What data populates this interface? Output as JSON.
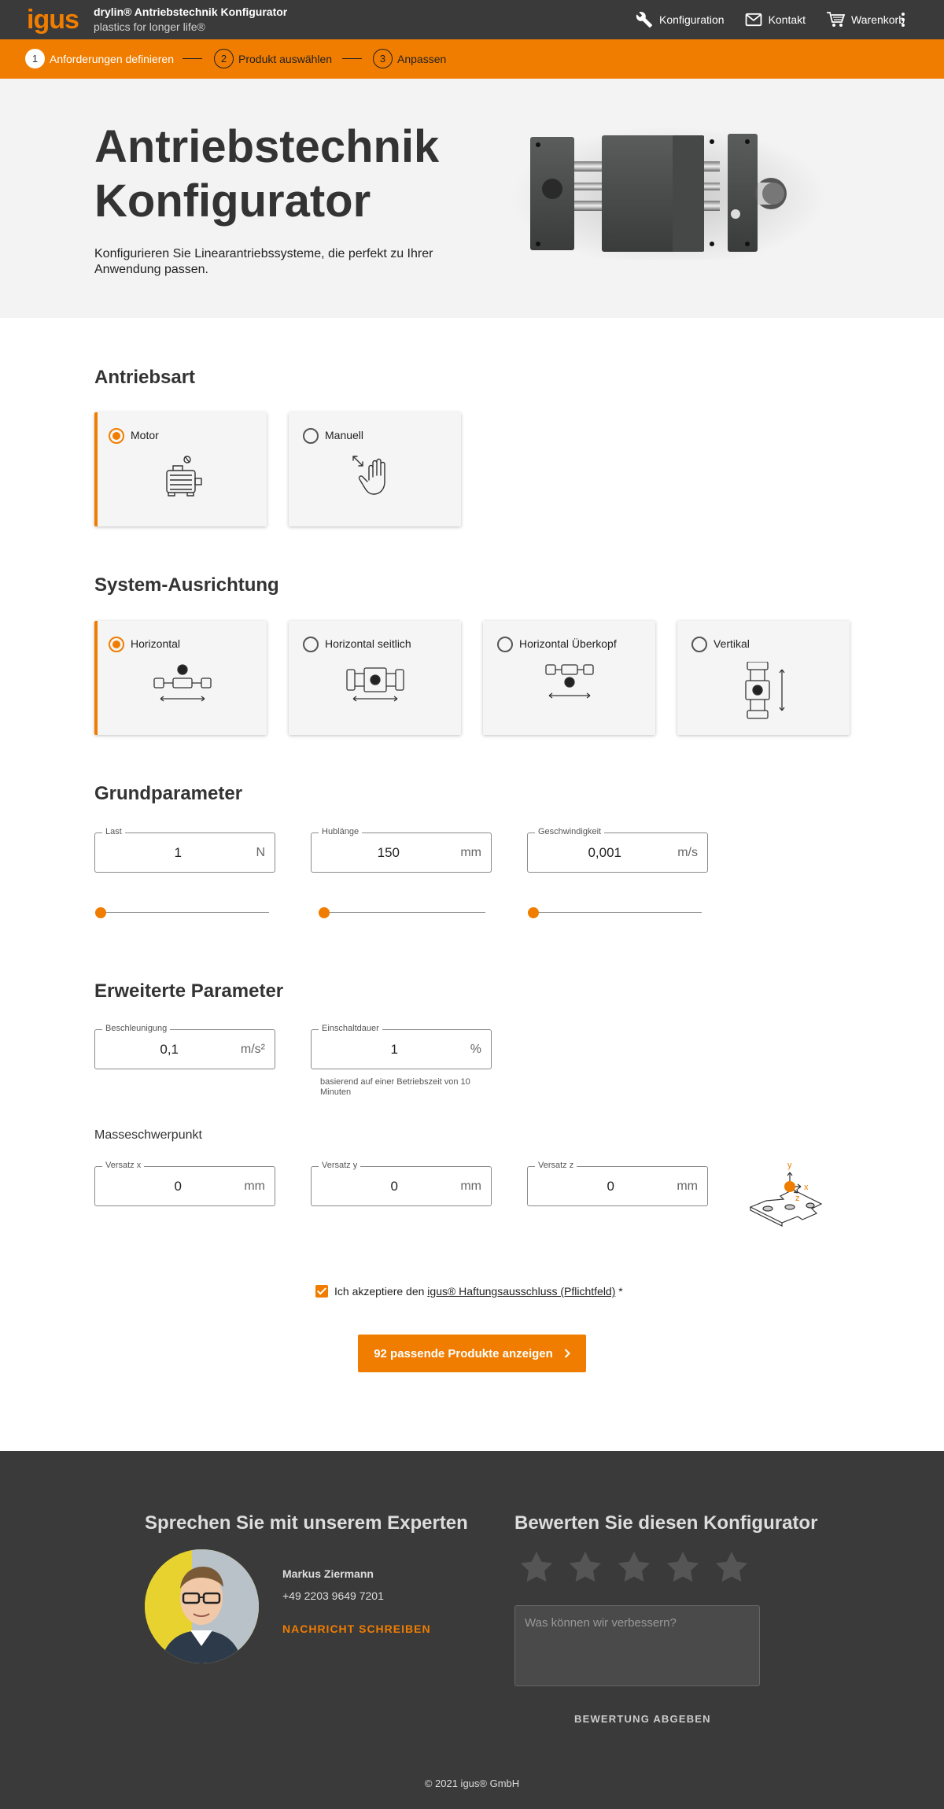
{
  "header": {
    "logo": "igus",
    "title": "drylin® Antriebstechnik Konfigurator",
    "subtitle": "plastics for longer life®",
    "nav": [
      {
        "label": "Konfiguration",
        "icon": "wrench-icon"
      },
      {
        "label": "Kontakt",
        "icon": "mail-icon"
      },
      {
        "label": "Warenkorb",
        "icon": "cart-icon"
      }
    ]
  },
  "stepper": [
    {
      "num": "1",
      "label": "Anforderungen definieren",
      "active": true
    },
    {
      "num": "2",
      "label": "Produkt auswählen",
      "active": false
    },
    {
      "num": "3",
      "label": "Anpassen",
      "active": false
    }
  ],
  "hero": {
    "title": "Antriebstechnik Konfigurator",
    "text": "Konfigurieren Sie Linearantriebssysteme, die perfekt zu Ihrer Anwendung passen."
  },
  "drive_type": {
    "title": "Antriebsart",
    "options": [
      {
        "label": "Motor",
        "selected": true,
        "icon": "motor-icon"
      },
      {
        "label": "Manuell",
        "selected": false,
        "icon": "hand-icon"
      }
    ]
  },
  "orientation": {
    "title": "System-Ausrichtung",
    "options": [
      {
        "label": "Horizontal",
        "selected": true,
        "icon": "horizontal-icon"
      },
      {
        "label": "Horizontal seitlich",
        "selected": false,
        "icon": "horizontal-side-icon"
      },
      {
        "label": "Horizontal Überkopf",
        "selected": false,
        "icon": "horizontal-overhead-icon"
      },
      {
        "label": "Vertikal",
        "selected": false,
        "icon": "vertical-icon"
      }
    ]
  },
  "basic": {
    "title": "Grundparameter",
    "fields": [
      {
        "label": "Last",
        "value": "1",
        "unit": "N",
        "slider_fraction": 0.0
      },
      {
        "label": "Hublänge",
        "value": "150",
        "unit": "mm",
        "slider_fraction": 0.0
      },
      {
        "label": "Geschwindigkeit",
        "value": "0,001",
        "unit": "m/s",
        "slider_fraction": 0.0
      }
    ]
  },
  "advanced": {
    "title": "Erweiterte Parameter",
    "fields": [
      {
        "label": "Beschleunigung",
        "value": "0,1",
        "unit": "m/s²"
      },
      {
        "label": "Einschaltdauer",
        "value": "1",
        "unit": "%"
      }
    ],
    "duty_hint": "basierend auf einer Betriebszeit von 10 Minuten",
    "center_of_mass": {
      "title": "Masseschwerpunkt",
      "fields": [
        {
          "label": "Versatz x",
          "value": "0",
          "unit": "mm"
        },
        {
          "label": "Versatz y",
          "value": "0",
          "unit": "mm"
        },
        {
          "label": "Versatz z",
          "value": "0",
          "unit": "mm"
        }
      ],
      "axes": [
        "y",
        "x",
        "z"
      ]
    }
  },
  "consent": {
    "prefix": "Ich akzeptiere den ",
    "link": "igus® Haftungsausschluss (Pflichtfeld)",
    "suffix": " *",
    "checked": true
  },
  "cta": {
    "label": "92 passende Produkte anzeigen"
  },
  "footer": {
    "expert_title": "Sprechen Sie mit unserem Experten",
    "expert_name": "Markus Ziermann",
    "expert_phone": "+49 2203 9649 7201",
    "expert_message": "NACHRICHT SCHREIBEN",
    "rating_title": "Bewerten Sie diesen Konfigurator",
    "stars_total": 5,
    "stars_selected": 0,
    "feedback_placeholder": "Was können wir verbessern?",
    "rate_button": "BEWERTUNG ABGEBEN",
    "copyright": "© 2021 igus® GmbH"
  },
  "colors": {
    "accent": "#f07d00",
    "header": "#3a3a3a",
    "footer": "#3a3a3a"
  }
}
